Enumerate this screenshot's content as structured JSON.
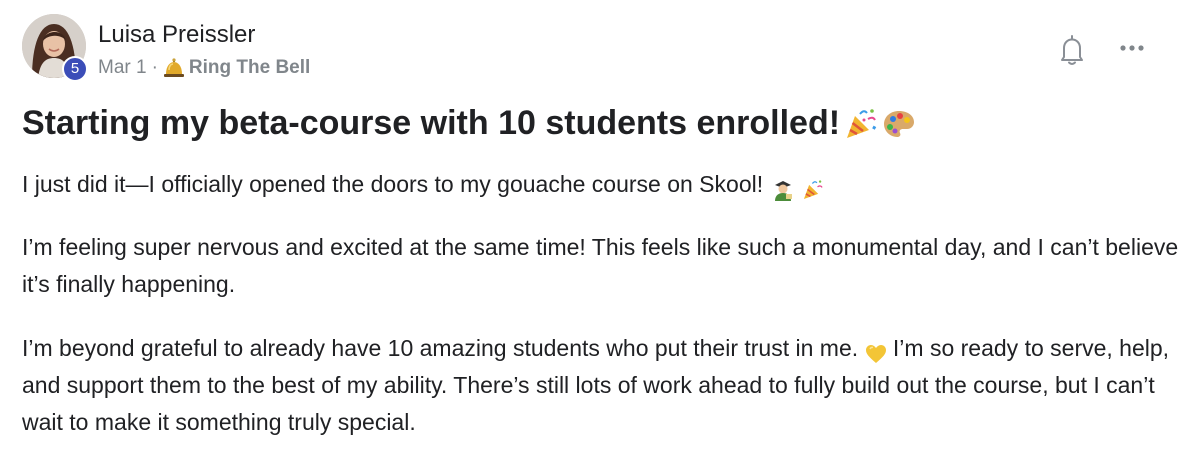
{
  "post": {
    "author": {
      "name": "Luisa Preissler",
      "level": "5"
    },
    "meta": {
      "date": "Mar 1",
      "separator": "·",
      "category": "Ring The Bell",
      "category_icon": "bellhop-bell-icon"
    },
    "title": {
      "text": "Starting my beta-course with 10 students enrolled!",
      "emojis": [
        "party-popper-icon",
        "artist-palette-icon"
      ]
    },
    "paragraphs": [
      {
        "text": "I just did it—I officially opened the doors to my gouache course on Skool!",
        "emojis": [
          "artist-person-icon",
          "party-popper-icon"
        ]
      },
      {
        "text": "I’m feeling super nervous and excited at the same time! This feels like such a monumental day, and I can’t believe it’s finally happening."
      },
      {
        "text_before": "I’m beyond grateful to already have 10 amazing students who put their trust in me.",
        "emoji": "yellow-heart-icon",
        "text_after": "I’m so ready to serve, help, and support them to the best of my ability. There’s still lots of work ahead to fully build out the course, but I can’t wait to make it something truly special."
      }
    ],
    "actions": {
      "notify_icon": "bell-outline-icon",
      "more_icon": "more-horizontal-icon"
    },
    "colors": {
      "badge": "#3b4db8",
      "meta_text": "#80868b",
      "text": "#202124"
    }
  }
}
